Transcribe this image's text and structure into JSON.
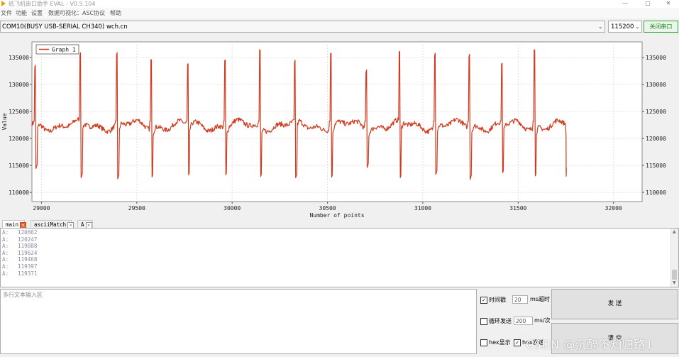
{
  "window": {
    "title": "纸飞机串口助手 EVAL - V0.5.104",
    "controls": [
      "—",
      "▢",
      "✕"
    ]
  },
  "menu": [
    "文件",
    "功能",
    "设置",
    "数据可视化：ASC协议",
    "帮助"
  ],
  "port": {
    "selected": "COM10(BUSY  USB-SERIAL CH340) wch.cn",
    "baud": "115200",
    "close_label": "关闭串口"
  },
  "tabs": [
    {
      "label": "main",
      "close": "✕"
    },
    {
      "label": "asciiMatch",
      "close": "✕"
    },
    {
      "label": "A",
      "close": "✕"
    }
  ],
  "log": [
    {
      "key": "A:",
      "value": "120662"
    },
    {
      "key": "A:",
      "value": "120247"
    },
    {
      "key": "A:",
      "value": "119888"
    },
    {
      "key": "A:",
      "value": "119624"
    },
    {
      "key": "A:",
      "value": "119468"
    },
    {
      "key": "A:",
      "value": "119397"
    },
    {
      "key": "A:",
      "value": "119371"
    }
  ],
  "send": {
    "placeholder": "多行文本输入区",
    "timestamp_label": "时间戳",
    "timeout_value": "20",
    "timeout_unit": "ms超时",
    "loop_label": "循环发送",
    "loop_value": "200",
    "loop_unit": "ms/次",
    "hex_display_label": "hex显示",
    "hex_send_label": "hex发送",
    "send_button": "发 送",
    "clear_button": "清 空"
  },
  "watermark": "CSDN @沉醉不知归路1",
  "colors": {
    "series": "#d03a1e",
    "close_port_border": "#3aa33a",
    "grid": "#e0e0e0",
    "active_tab_close": "#e46a3a"
  },
  "chart_data": {
    "type": "line",
    "title": "",
    "xlabel": "Number of points",
    "ylabel": "Value",
    "xlim": [
      28950,
      32150
    ],
    "ylim": [
      108300,
      137900
    ],
    "xticks": [
      29000,
      29500,
      30000,
      30500,
      31000,
      31500,
      32000
    ],
    "yticks": [
      110000,
      115000,
      120000,
      125000,
      130000,
      135000
    ],
    "grid": true,
    "legend": "top-left",
    "right_axis": true,
    "series": [
      {
        "name": "Graph 1",
        "color": "#d03a1e",
        "x_range": [
          28950,
          31750
        ],
        "baseline": 122400,
        "noise": 900,
        "wave_amplitude": 700,
        "wave_period": 45,
        "beats": [
          {
            "x": 28968,
            "peak": 133600,
            "trough": 114300
          },
          {
            "x": 29205,
            "peak": 135900,
            "trough": 112600
          },
          {
            "x": 29397,
            "peak": 135900,
            "trough": 112400
          },
          {
            "x": 29575,
            "peak": 134800,
            "trough": 112500
          },
          {
            "x": 29768,
            "peak": 134000,
            "trough": 113000
          },
          {
            "x": 29963,
            "peak": 134700,
            "trough": 113000
          },
          {
            "x": 30145,
            "peak": 136600,
            "trough": 112600
          },
          {
            "x": 30330,
            "peak": 134500,
            "trough": 112600
          },
          {
            "x": 30518,
            "peak": 136000,
            "trough": 112600
          },
          {
            "x": 30705,
            "peak": 132700,
            "trough": 114500
          },
          {
            "x": 30878,
            "peak": 136300,
            "trough": 112500
          },
          {
            "x": 31065,
            "peak": 135800,
            "trough": 113200
          },
          {
            "x": 31245,
            "peak": 135600,
            "trough": 112300
          },
          {
            "x": 31415,
            "peak": 134100,
            "trough": 113400
          },
          {
            "x": 31585,
            "peak": 136600,
            "trough": 112700
          }
        ],
        "end_value": 113000
      }
    ]
  }
}
